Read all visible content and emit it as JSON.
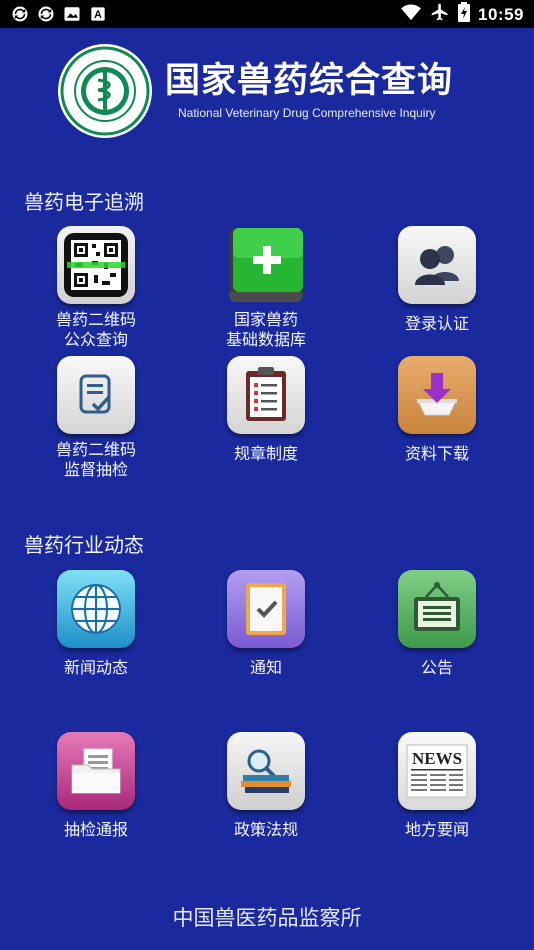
{
  "status_bar": {
    "time": "10:59",
    "left_icons": [
      "sync-icon",
      "sync-icon",
      "photo-icon",
      "a-icon"
    ],
    "right_icons": [
      "wifi-icon",
      "airplane-icon",
      "battery-icon"
    ]
  },
  "header": {
    "logo_text": "中国兽医药品监察所",
    "title": "国家兽药综合查询",
    "subtitle": "National Veterinary Drug Comprehensive Inquiry"
  },
  "sections": [
    {
      "title": "兽药电子追溯",
      "items": [
        {
          "label_line1": "兽药二维码",
          "label_line2": "公众查询",
          "icon": "qr-code-icon"
        },
        {
          "label_line1": "国家兽药",
          "label_line2": "基础数据库",
          "icon": "database-book-icon"
        },
        {
          "label_line1": "登录认证",
          "label_line2": "",
          "icon": "users-icon"
        },
        {
          "label_line1": "兽药二维码",
          "label_line2": "监督抽检",
          "icon": "document-check-icon"
        },
        {
          "label_line1": "规章制度",
          "label_line2": "",
          "icon": "clipboard-icon"
        },
        {
          "label_line1": "资料下载",
          "label_line2": "",
          "icon": "download-icon"
        }
      ]
    },
    {
      "title": "兽药行业动态",
      "items": [
        {
          "label_line1": "新闻动态",
          "label_line2": "",
          "icon": "globe-icon"
        },
        {
          "label_line1": "通知",
          "label_line2": "",
          "icon": "notice-icon"
        },
        {
          "label_line1": "公告",
          "label_line2": "",
          "icon": "bulletin-board-icon"
        },
        {
          "label_line1": "抽检通报",
          "label_line2": "",
          "icon": "folder-icon"
        },
        {
          "label_line1": "政策法规",
          "label_line2": "",
          "icon": "law-books-icon"
        },
        {
          "label_line1": "地方要闻",
          "label_line2": "",
          "icon": "newspaper-icon"
        }
      ]
    }
  ],
  "footer": {
    "text": "中国兽医药品监察所"
  },
  "colors": {
    "background": "#1a2a9e",
    "status_bar": "#000000"
  }
}
